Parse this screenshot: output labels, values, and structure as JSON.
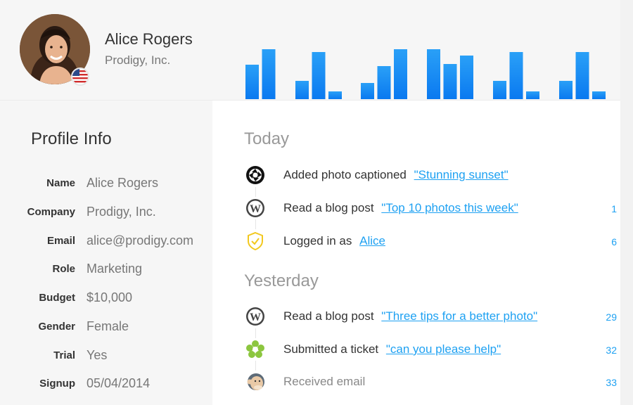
{
  "colors": {
    "accent": "#1ea1f2",
    "bar_top": "#2aa0f7",
    "bar_bottom": "#0a79f0"
  },
  "user": {
    "name": "Alice Rogers",
    "company": "Prodigy, Inc.",
    "flag": "us-flag-icon"
  },
  "activity_chart": {
    "type": "bar",
    "groups": [
      [
        0.69,
        1.0,
        0
      ],
      [
        0.37,
        0.94,
        0.16
      ],
      [
        0.33,
        0.66,
        1.0
      ],
      [
        1.0,
        0.71,
        0.87
      ],
      [
        0.37,
        0.94,
        0.16
      ],
      [
        0.37,
        0.94,
        0.16
      ]
    ]
  },
  "profile": {
    "title": "Profile Info",
    "fields": [
      {
        "label": "Name",
        "value": "Alice Rogers"
      },
      {
        "label": "Company",
        "value": "Prodigy, Inc."
      },
      {
        "label": "Email",
        "value": "alice@prodigy.com"
      },
      {
        "label": "Role",
        "value": "Marketing"
      },
      {
        "label": "Budget",
        "value": "$10,000"
      },
      {
        "label": "Gender",
        "value": "Female"
      },
      {
        "label": "Trial",
        "value": "Yes"
      },
      {
        "label": "Signup",
        "value": "05/04/2014"
      }
    ]
  },
  "feed": {
    "today_title": "Today",
    "yesterday_title": "Yesterday",
    "today": [
      {
        "icon": "camera-shutter-icon",
        "text": "Added photo captioned",
        "link": "\"Stunning sunset\"",
        "count": ""
      },
      {
        "icon": "wordpress-icon",
        "text": "Read a blog post",
        "link": "\"Top 10 photos this week\"",
        "count": "1"
      },
      {
        "icon": "shield-check-icon",
        "text": "Logged in as",
        "link": "Alice",
        "count": "6"
      }
    ],
    "yesterday": [
      {
        "icon": "wordpress-icon",
        "text": "Read a blog post",
        "link": "\"Three tips for a better photo\"",
        "count": "29"
      },
      {
        "icon": "flower-icon",
        "text": "Submitted a ticket",
        "link": "\"can you please help\"",
        "count": "32"
      },
      {
        "icon": "mailchimp-icon",
        "text": "Received email",
        "link": "",
        "count": "33"
      }
    ]
  }
}
